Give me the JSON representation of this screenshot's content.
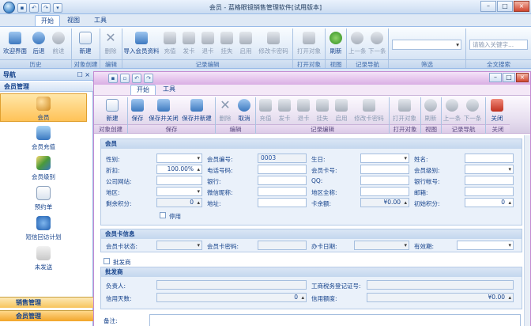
{
  "app": {
    "title": "会员 - 蓝格眼镜销售管理软件[试用版本]"
  },
  "outer_tabs": [
    "开始",
    "视图",
    "工具"
  ],
  "outer_ribbon": {
    "groups": [
      "历史",
      "对象创建",
      "编辑",
      "记录编辑",
      "打开对象",
      "视图",
      "记录导航",
      "筛选",
      "全文搜索"
    ],
    "buttons": [
      "欢迎界面",
      "后退",
      "前进",
      "新建",
      "删除",
      "导入会员资料",
      "充值",
      "发卡",
      "退卡",
      "挂失",
      "启用",
      "修改卡密码",
      "打开对象",
      "刷新",
      "上一条",
      "下一条"
    ],
    "search_placeholder": "请输入关键字..."
  },
  "sidebar": {
    "title": "导航",
    "pin": "☐ ×",
    "group_top": "会员管理",
    "items": [
      "会员",
      "会员充值",
      "会员级别",
      "预约单",
      "短信回访计划",
      "未发送"
    ],
    "group_sales": "销售管理",
    "group_member": "会员管理"
  },
  "inner": {
    "tabs": [
      "开始",
      "工具"
    ],
    "groups": [
      "对象创建",
      "保存",
      "编辑",
      "记录编辑",
      "打开对象",
      "视图",
      "记录导航",
      "关闭"
    ],
    "buttons": [
      "新建",
      "保存",
      "保存并关闭",
      "保存并新建",
      "删除",
      "取消",
      "充值",
      "发卡",
      "退卡",
      "挂失",
      "启用",
      "修改卡密码",
      "打开对象",
      "刷新",
      "上一条",
      "下一条",
      "关闭"
    ]
  },
  "form": {
    "sec_member": "会员",
    "sec_card": "会员卡信息",
    "sec_wholesale_check": "批发商",
    "sec_wholesale": "批发商",
    "labels": {
      "gender": "性别:",
      "member_no": "会员编号:",
      "birthday": "生日:",
      "name": "姓名:",
      "discount": "折扣:",
      "phone": "电话号码:",
      "card_no": "会员卡号:",
      "level": "会员级别:",
      "website": "公司网站:",
      "bank": "银行:",
      "qq": "QQ:",
      "bank_account": "银行帐号:",
      "region": "地区:",
      "wechat": "微信昵称:",
      "region_full": "地区全称:",
      "email": "邮箱:",
      "points": "剩余积分:",
      "address": "地址:",
      "balance": "卡余额:",
      "initial_points": "初始积分:",
      "disabled": "停用",
      "card_status": "会员卡状态:",
      "card_password": "会员卡密码:",
      "card_date": "办卡日期:",
      "validity": "有效期:",
      "contact": "负责人:",
      "tax_no": "工商税务登记证号:",
      "credit_days": "信用天数:",
      "credit_limit": "信用额度:",
      "remark": "备注:"
    },
    "values": {
      "discount": "100.00%",
      "member_no": "0003",
      "points": "0",
      "balance": "¥0.00",
      "initial_points": "0",
      "credit_days": "0",
      "credit_limit": "¥0.00"
    }
  }
}
